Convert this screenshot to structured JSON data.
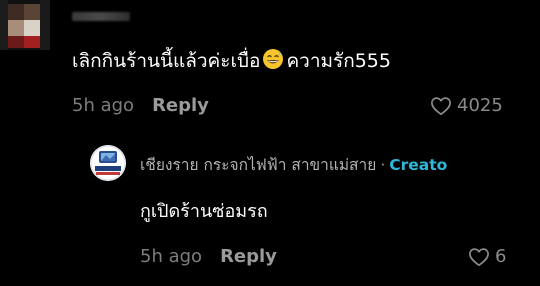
{
  "comment": {
    "text_before_emoji": "เลิกกินร้านนี้แล้วค่ะเบื่อ",
    "emoji_icon": "grinning-sweat-icon",
    "text_after_emoji": "ความรัก555",
    "time": "5h ago",
    "reply_label": "Reply",
    "like_count": "4025"
  },
  "reply": {
    "author": "เชียงราย กระจกไฟฟ้า สาขาแม่สาย",
    "separator": "·",
    "badge": "Creato",
    "text": "กูเปิดร้านซ่อมรถ",
    "time": "5h ago",
    "reply_label": "Reply",
    "like_count": "6"
  },
  "colors": {
    "background": "#000000",
    "text": "#ffffff",
    "muted": "#8a8a8a",
    "creator_accent": "#2fb6dc"
  }
}
